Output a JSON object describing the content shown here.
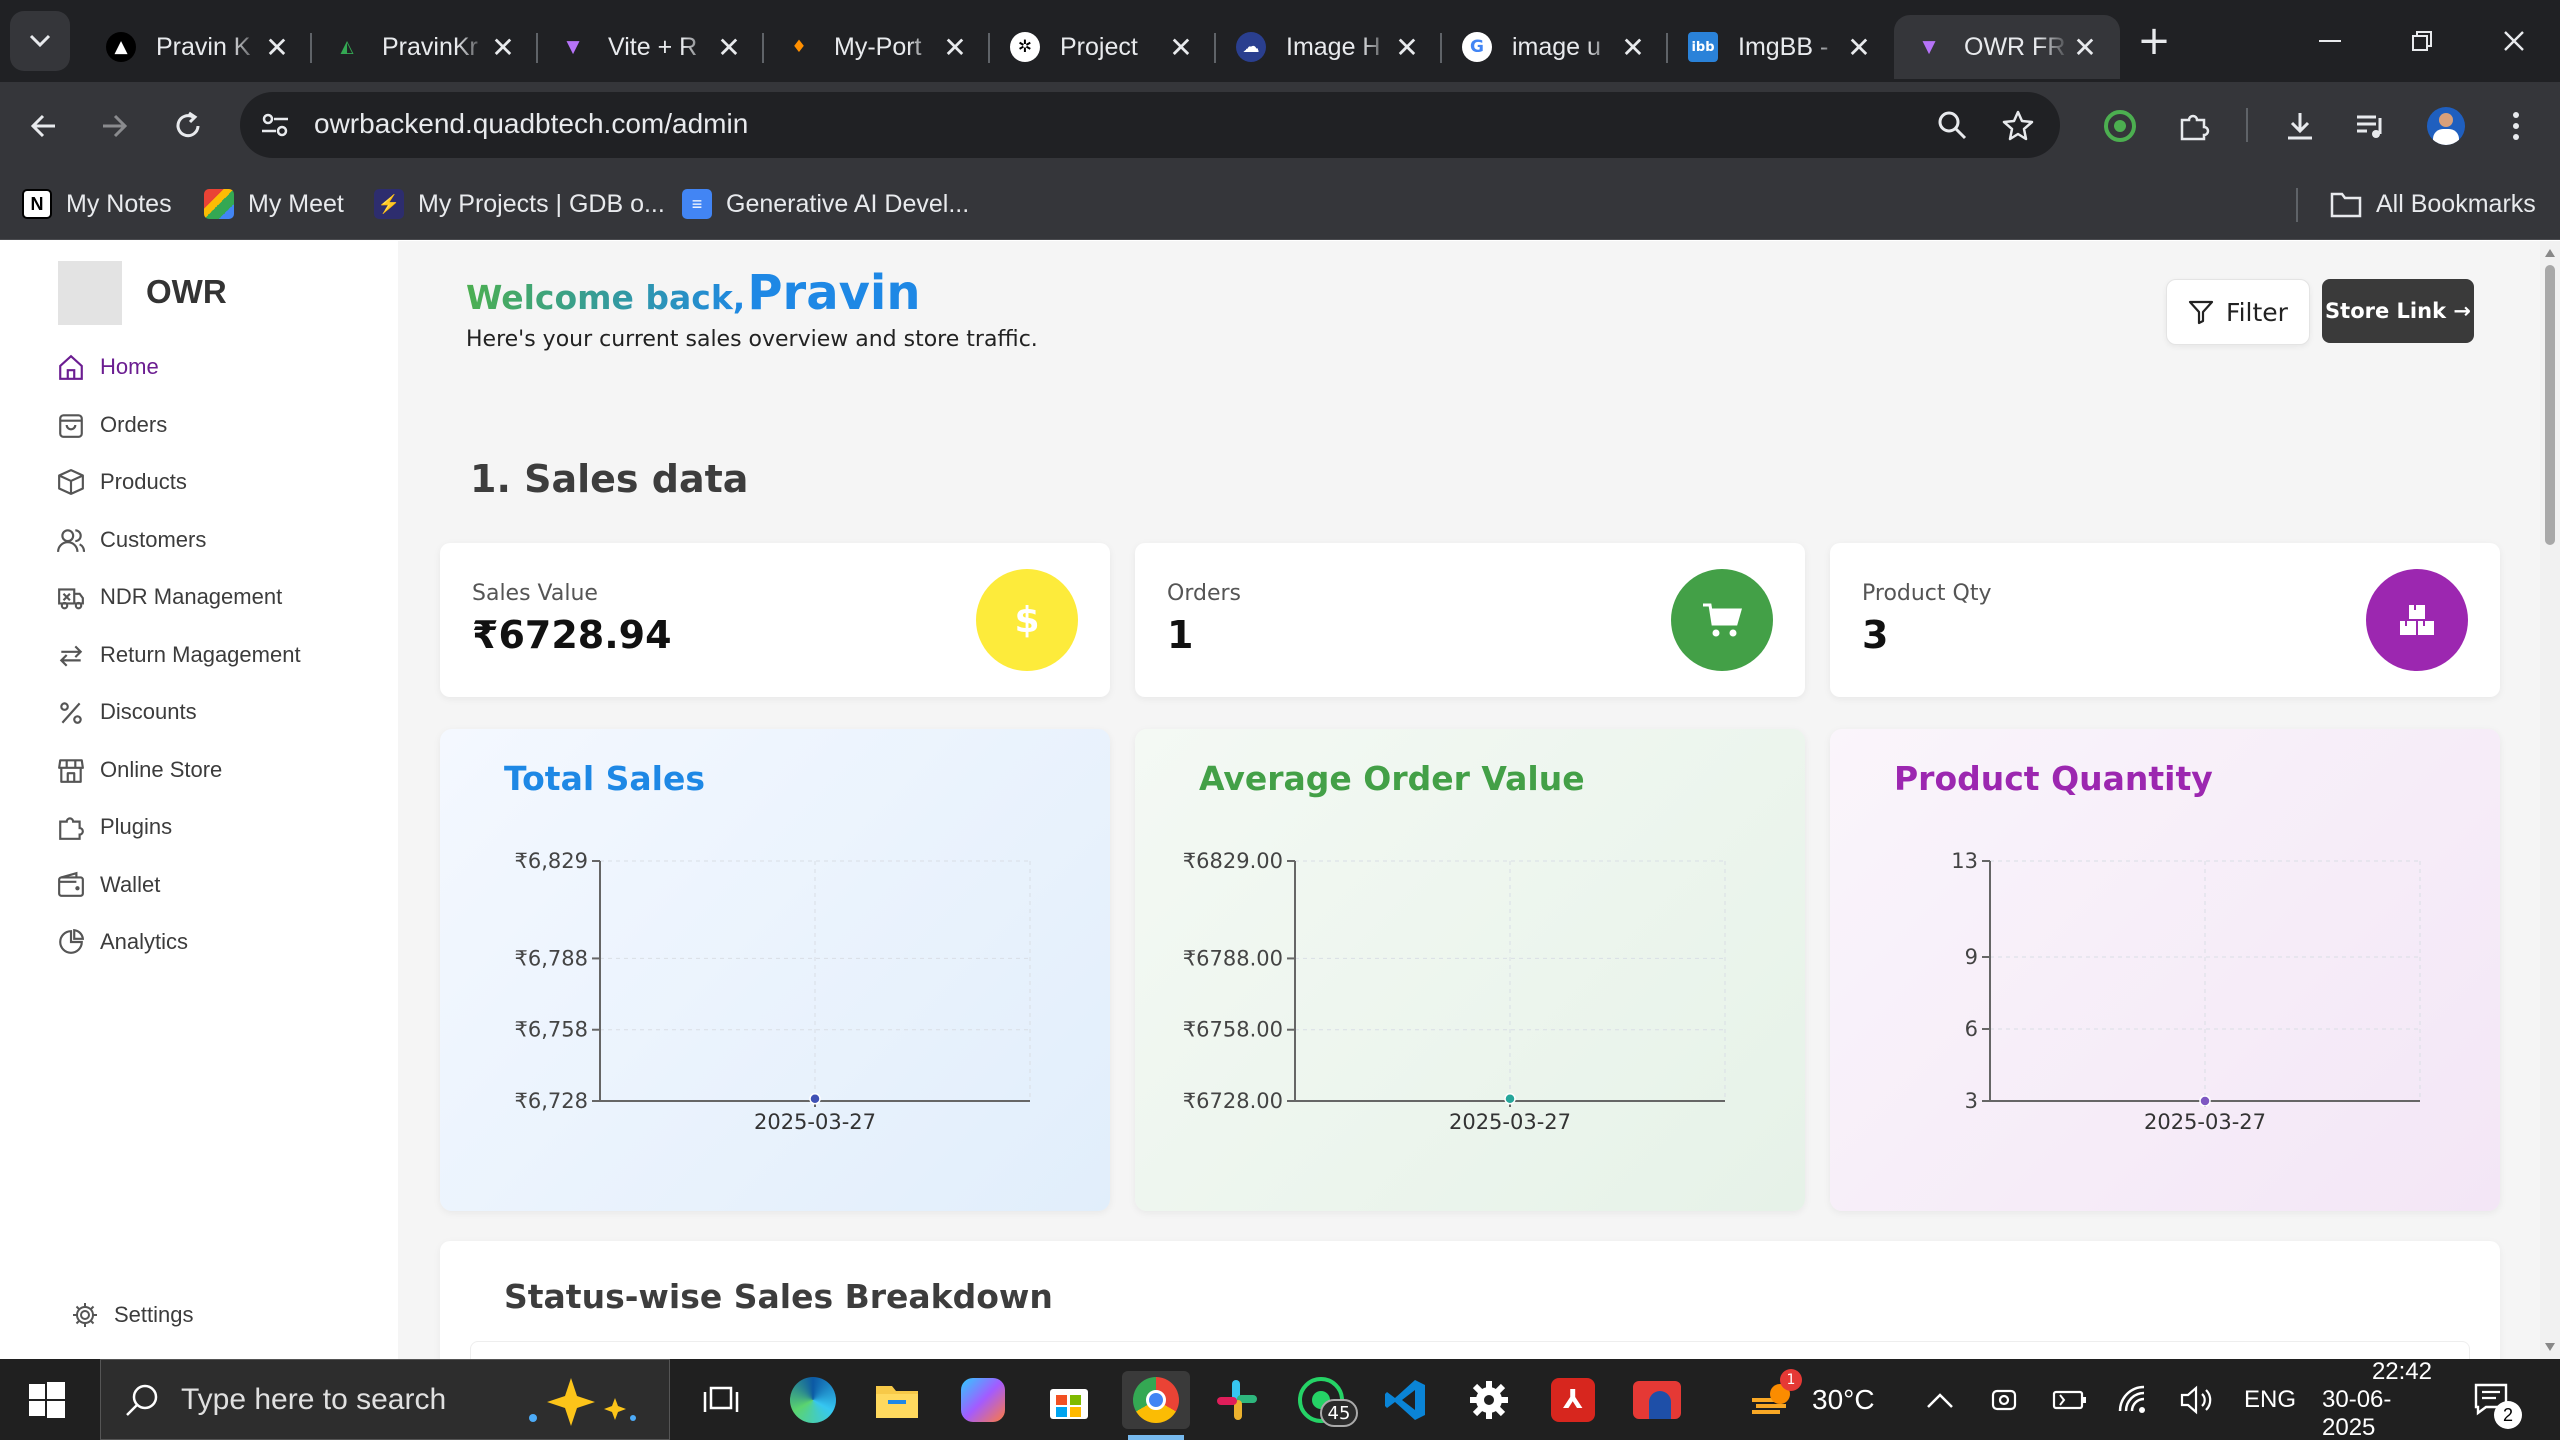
{
  "browser": {
    "tabs": [
      {
        "title": "Pravin K",
        "icon": "vercel-icon"
      },
      {
        "title": "PravinKr",
        "icon": "google-drive-icon"
      },
      {
        "title": "Vite + R",
        "icon": "vite-icon"
      },
      {
        "title": "My-Port",
        "icon": "firebase-icon"
      },
      {
        "title": "Project",
        "icon": "openai-icon"
      },
      {
        "title": "Image H",
        "icon": "image-host-icon"
      },
      {
        "title": "image u",
        "icon": "google-icon"
      },
      {
        "title": "ImgBB -",
        "icon": "imgbb-icon"
      },
      {
        "title": "OWR FR",
        "icon": "vite-icon",
        "active": true
      }
    ],
    "url": "owrbackend.quadbtech.com/admin",
    "bookmarks": [
      {
        "label": "My Notes",
        "icon": "notion-icon"
      },
      {
        "label": "My Meet",
        "icon": "google-meet-icon"
      },
      {
        "label": "My Projects | GDB o...",
        "icon": "bolt-icon"
      },
      {
        "label": "Generative AI Devel...",
        "icon": "google-docs-icon"
      }
    ],
    "all_bookmarks": "All Bookmarks"
  },
  "sidebar": {
    "brand": "OWR",
    "items": [
      {
        "label": "Home",
        "icon": "home-icon",
        "active": true
      },
      {
        "label": "Orders",
        "icon": "orders-icon"
      },
      {
        "label": "Products",
        "icon": "box-icon"
      },
      {
        "label": "Customers",
        "icon": "users-icon"
      },
      {
        "label": "NDR Management",
        "icon": "truck-icon"
      },
      {
        "label": "Return Magagement",
        "icon": "return-icon"
      },
      {
        "label": "Discounts",
        "icon": "percent-icon"
      },
      {
        "label": "Online Store",
        "icon": "store-icon"
      },
      {
        "label": "Plugins",
        "icon": "puzzle-icon"
      },
      {
        "label": "Wallet",
        "icon": "wallet-icon"
      },
      {
        "label": "Analytics",
        "icon": "pie-chart-icon"
      }
    ],
    "settings": "Settings"
  },
  "header": {
    "welcome": "Welcome back,",
    "username": "Pravin",
    "subtitle": "Here's your current sales overview and store traffic.",
    "filter_label": "Filter",
    "store_link_label": "Store Link →"
  },
  "section_title": "1. Sales data",
  "stats": [
    {
      "label": "Sales Value",
      "value": "₹6728.94",
      "icon": "dollar-icon",
      "color": "#fdeb3b"
    },
    {
      "label": "Orders",
      "value": "1",
      "icon": "cart-icon",
      "color": "#43a047"
    },
    {
      "label": "Product Qty",
      "value": "3",
      "icon": "boxes-icon",
      "color": "#9c27b0"
    }
  ],
  "chart_data": [
    {
      "type": "line",
      "title": "Total Sales",
      "title_color": "#1e88e5",
      "point_color": "#3f51b5",
      "x": [
        "2025-03-27"
      ],
      "y_ticks": [
        "₹6,728",
        "₹6,758",
        "₹6,788",
        "₹6,829"
      ],
      "y_tick_values": [
        6728,
        6758,
        6788,
        6829
      ],
      "ylim": [
        6728,
        6829
      ],
      "values": [
        6728.94
      ],
      "background": [
        "#f4f8ff",
        "#e1eefb"
      ]
    },
    {
      "type": "line",
      "title": "Average Order Value",
      "title_color": "#43a047",
      "point_color": "#26a69a",
      "x": [
        "2025-03-27"
      ],
      "y_ticks": [
        "₹6728.00",
        "₹6758.00",
        "₹6788.00",
        "₹6829.00"
      ],
      "y_tick_values": [
        6728,
        6758,
        6788,
        6829
      ],
      "ylim": [
        6728,
        6829
      ],
      "values": [
        6728.94
      ],
      "background": [
        "#f4f9f4",
        "#e6f2e8"
      ]
    },
    {
      "type": "line",
      "title": "Product Quantity",
      "title_color": "#9c27b0",
      "point_color": "#7e57c2",
      "x": [
        "2025-03-27"
      ],
      "y_ticks": [
        "3",
        "6",
        "9",
        "13"
      ],
      "y_tick_values": [
        3,
        6,
        9,
        13
      ],
      "ylim": [
        3,
        13
      ],
      "values": [
        3
      ],
      "background": [
        "#faf5fb",
        "#f3e6f6"
      ]
    }
  ],
  "breakdown_title": "Status-wise Sales Breakdown",
  "taskbar": {
    "search_placeholder": "Type here to search",
    "weather": "30°C",
    "weather_badge": "1",
    "whatsapp_badge": "45",
    "language": "ENG",
    "time": "22:42",
    "date": "30-06-2025",
    "notification_count": "2"
  }
}
